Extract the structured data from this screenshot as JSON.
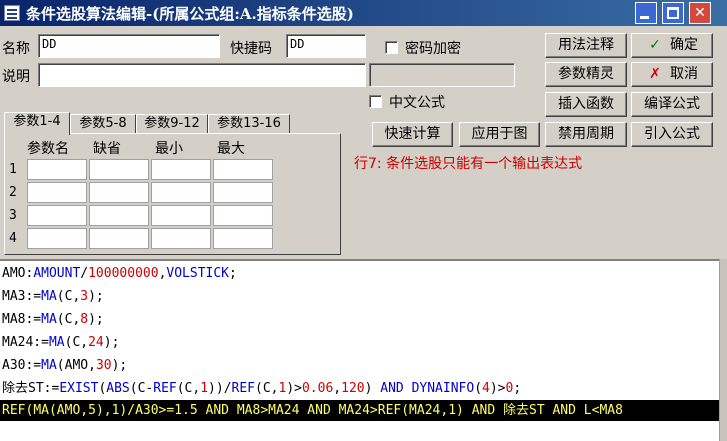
{
  "window": {
    "title": "条件选股算法编辑-(所属公式组:A.指标条件选股)",
    "min_label": "",
    "max_label": "",
    "close_label": "✕"
  },
  "form": {
    "name_label": "名称",
    "name_value": "DD",
    "shortcut_label": "快捷码",
    "shortcut_value": "DD",
    "password_label": "密码加密",
    "desc_label": "说明",
    "desc_value": "",
    "side_field_value": "",
    "chinese_formula_label": "中文公式"
  },
  "buttons": {
    "usage_note": "用法注释",
    "ok": "确定",
    "ok_icon": "✓",
    "param_wizard": "参数精灵",
    "cancel": "取消",
    "cancel_icon": "✗",
    "insert_func": "插入函数",
    "compile": "编译公式",
    "quick_calc": "快速计算",
    "apply_chart": "应用于图",
    "disable_period": "禁用周期",
    "import_formula": "引入公式"
  },
  "tabs": [
    "参数1-4",
    "参数5-8",
    "参数9-12",
    "参数13-16"
  ],
  "param_grid": {
    "headers": [
      "参数名",
      "缺省",
      "最小",
      "最大"
    ],
    "rows": [
      "1",
      "2",
      "3",
      "4"
    ]
  },
  "error_message": "行7: 条件选股只能有一个输出表达式",
  "code_lines": [
    [
      [
        "t",
        "AMO:"
      ],
      [
        "k",
        "AMOUNT"
      ],
      [
        "t",
        "/"
      ],
      [
        "n",
        "100000000"
      ],
      [
        "t",
        ","
      ],
      [
        "k",
        "VOLSTICK"
      ],
      [
        "t",
        ";"
      ]
    ],
    [
      [
        "t",
        "MA3:="
      ],
      [
        "k",
        "MA"
      ],
      [
        "t",
        "(C,"
      ],
      [
        "n",
        "3"
      ],
      [
        "t",
        ");"
      ]
    ],
    [
      [
        "t",
        "MA8:="
      ],
      [
        "k",
        "MA"
      ],
      [
        "t",
        "(C,"
      ],
      [
        "n",
        "8"
      ],
      [
        "t",
        ");"
      ]
    ],
    [
      [
        "t",
        "MA24:="
      ],
      [
        "k",
        "MA"
      ],
      [
        "t",
        "(C,"
      ],
      [
        "n",
        "24"
      ],
      [
        "t",
        ");"
      ]
    ],
    [
      [
        "t",
        "A30:="
      ],
      [
        "k",
        "MA"
      ],
      [
        "t",
        "(AMO,"
      ],
      [
        "n",
        "30"
      ],
      [
        "t",
        ");"
      ]
    ],
    [
      [
        "t",
        "除去ST:="
      ],
      [
        "k",
        "EXIST"
      ],
      [
        "t",
        "("
      ],
      [
        "k",
        "ABS"
      ],
      [
        "t",
        "(C-"
      ],
      [
        "k",
        "REF"
      ],
      [
        "t",
        "(C,"
      ],
      [
        "n",
        "1"
      ],
      [
        "t",
        "))/"
      ],
      [
        "k",
        "REF"
      ],
      [
        "t",
        "(C,"
      ],
      [
        "n",
        "1"
      ],
      [
        "t",
        ")>"
      ],
      [
        "n",
        "0.06"
      ],
      [
        "t",
        ","
      ],
      [
        "n",
        "120"
      ],
      [
        "t",
        ") "
      ],
      [
        "k",
        "AND"
      ],
      [
        "t",
        " "
      ],
      [
        "k",
        "DYNAINFO"
      ],
      [
        "t",
        "("
      ],
      [
        "n",
        "4"
      ],
      [
        "t",
        ")>"
      ],
      [
        "n",
        "0"
      ],
      [
        "t",
        ";"
      ]
    ]
  ],
  "highlight_line": [
    [
      "k",
      "REF"
    ],
    [
      "t",
      "("
    ],
    [
      "k",
      "MA"
    ],
    [
      "t",
      "(AMO,"
    ],
    [
      "n",
      "5"
    ],
    [
      "t",
      "),"
    ],
    [
      "n",
      "1"
    ],
    [
      "t",
      ")/A30>="
    ],
    [
      "n",
      "1.5"
    ],
    [
      "t",
      " "
    ],
    [
      "k",
      "AND"
    ],
    [
      "t",
      " MA8>MA24 "
    ],
    [
      "k",
      "AND"
    ],
    [
      "t",
      " MA24>"
    ],
    [
      "k",
      "REF"
    ],
    [
      "t",
      "(MA24,"
    ],
    [
      "n",
      "1"
    ],
    [
      "t",
      ") "
    ],
    [
      "k",
      "AND"
    ],
    [
      "t",
      " 除去ST "
    ],
    [
      "k",
      "AND"
    ],
    [
      "t",
      " L<MA8"
    ]
  ],
  "colors": {
    "titlebar": "#0a246a",
    "keyword": "#0000cc",
    "number": "#cc0000",
    "error": "#cc0000",
    "highlight_bg": "#000000",
    "highlight_fg": "#ffff66"
  }
}
